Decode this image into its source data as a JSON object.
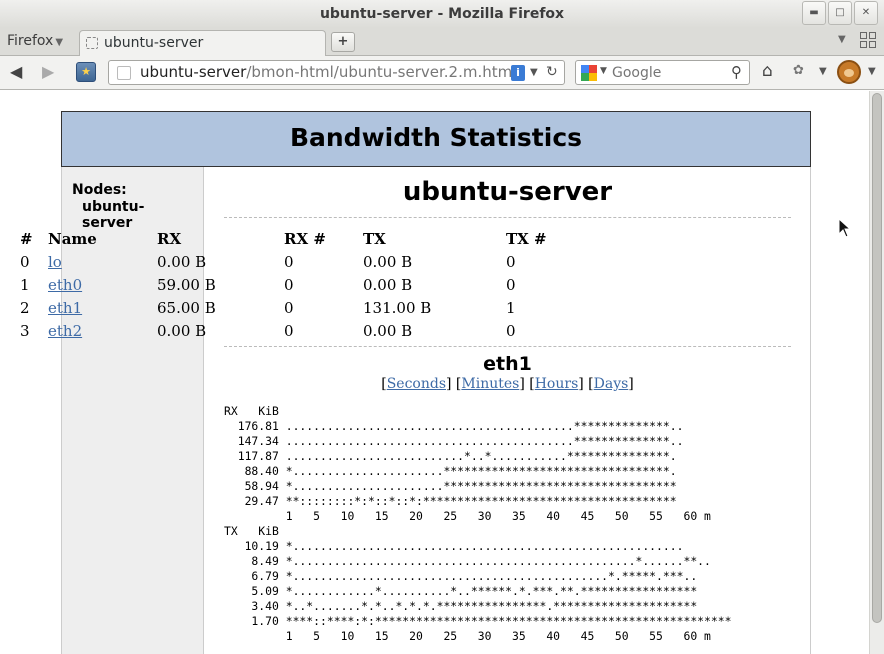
{
  "window": {
    "title": "ubuntu-server - Mozilla Firefox",
    "minimize_glyph": "▬",
    "maximize_glyph": "□",
    "close_glyph": "✕"
  },
  "tabs": {
    "app_menu_label": "Firefox",
    "app_menu_arrow": "▼",
    "active_tab_label": "ubuntu-server",
    "new_tab_glyph": "+",
    "list_tabs_glyph": "▼"
  },
  "navbar": {
    "back_glyph": "◀",
    "forward_glyph": "▶",
    "bookmark_glyph": "★",
    "url_host": "ubuntu-server",
    "url_path": "/bmon-html/ubuntu-server.2.m.html",
    "url_info_glyph": "i",
    "url_dropdown_glyph": "▼",
    "reload_glyph": "↻",
    "search_placeholder": "Google",
    "search_engine_dropdown_glyph": "▼",
    "search_go_glyph": "⚲",
    "home_glyph": "⌂",
    "addon_glyph": "✿",
    "addon_dropdown_glyph": "▼",
    "greasemonkey_dropdown_glyph": "▼"
  },
  "page": {
    "header": "Bandwidth Statistics",
    "sidebar": {
      "label": "Nodes:",
      "nodes": [
        "ubuntu-server"
      ]
    },
    "host_title": "ubuntu-server",
    "table": {
      "headers": [
        "#",
        "Name",
        "RX",
        "RX #",
        "TX",
        "TX #"
      ],
      "rows": [
        [
          "0",
          "lo",
          "0.00 B",
          "0",
          "0.00 B",
          "0"
        ],
        [
          "1",
          "eth0",
          "59.00 B",
          "0",
          "0.00 B",
          "0"
        ],
        [
          "2",
          "eth1",
          "65.00 B",
          "0",
          "131.00 B",
          "1"
        ],
        [
          "3",
          "eth2",
          "0.00 B",
          "0",
          "0.00 B",
          "0"
        ]
      ]
    },
    "interface_title": "eth1",
    "period_links": [
      "Seconds",
      "Minutes",
      "Hours",
      "Days"
    ],
    "rx_graph": "RX   KiB\n  176.81 ..........................................**************..\n  147.34 ..........................................**************..\n  117.87 ..........................*..*...........***************.\n   88.40 *......................*********************************.\n   58.94 *......................**********************************\n   29.47 **::::::::*:*::*::*:*************************************\n         1   5   10   15   20   25   30   35   40   45   50   55   60 m",
    "tx_graph": "TX   KiB\n   10.19 *.........................................................\n    8.49 *..................................................*......**..\n    6.79 *..............................................*.*****.***..\n    5.09 *............*..........*..******.*.***.**.*****************\n    3.40 *..*.......*.*..*.*.*.****************.*********************\n    1.70 ****::****:*:****************************************************\n         1   5   10   15   20   25   30   35   40   45   50   55   60 m"
  }
}
